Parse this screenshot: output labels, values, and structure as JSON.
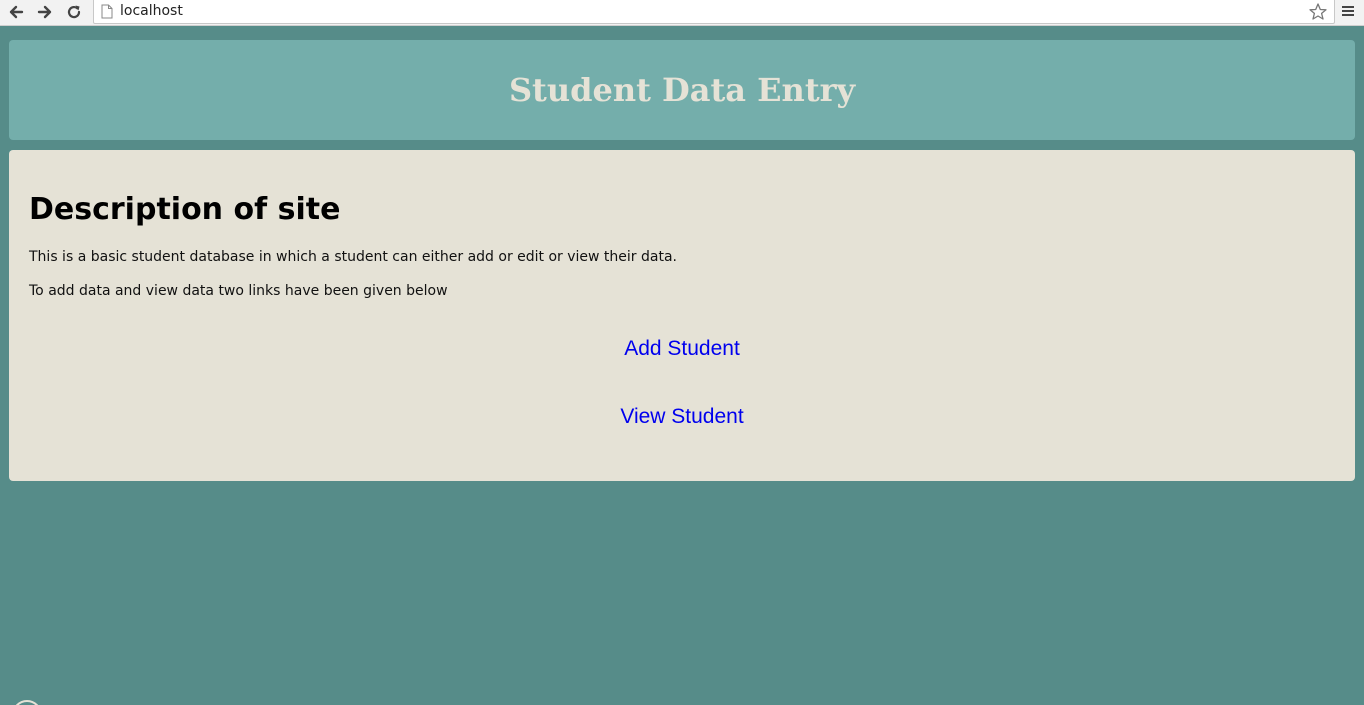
{
  "browser": {
    "url": "localhost",
    "back_icon": "back-arrow-icon",
    "forward_icon": "forward-arrow-icon",
    "reload_icon": "reload-icon",
    "bookmark_icon": "star-icon",
    "menu_icon": "hamburger-menu-icon"
  },
  "header": {
    "title": "Student Data Entry"
  },
  "main": {
    "heading": "Description of site",
    "paragraphs": [
      "This is a basic student database in which a student can either add or edit or view their data.",
      "To add data and view data two links have been given below"
    ],
    "links": [
      {
        "label": "Add Student"
      },
      {
        "label": "View Student"
      }
    ]
  },
  "colors": {
    "page_background": "#568c89",
    "header_background": "#74aeab",
    "panel_background": "#e5e2d6",
    "title_color": "#e5e2d6",
    "link_color": "#0000ee"
  }
}
